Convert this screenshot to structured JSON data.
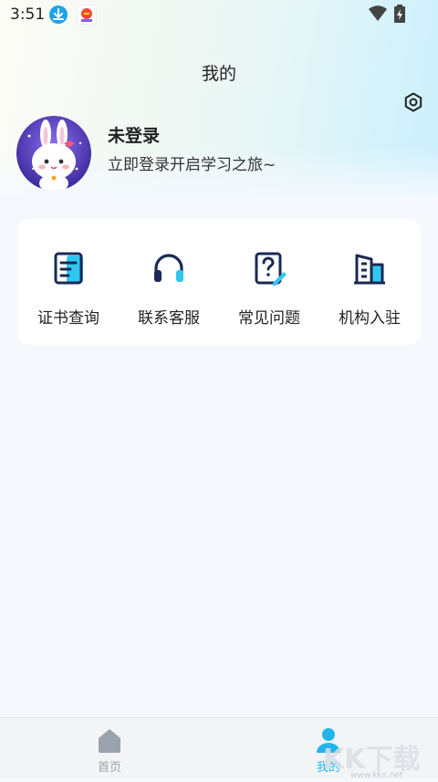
{
  "status_bar": {
    "time": "3:51"
  },
  "header": {
    "title": "我的"
  },
  "profile": {
    "name": "未登录",
    "subtitle": "立即登录开启学习之旅~"
  },
  "menu": {
    "items": [
      {
        "label": "证书查询",
        "icon": "certificate-icon"
      },
      {
        "label": "联系客服",
        "icon": "headset-icon"
      },
      {
        "label": "常见问题",
        "icon": "faq-icon"
      },
      {
        "label": "机构入驻",
        "icon": "building-icon"
      }
    ]
  },
  "tabbar": {
    "items": [
      {
        "label": "首页",
        "icon": "home-icon",
        "active": false
      },
      {
        "label": "我的",
        "icon": "user-icon",
        "active": true
      }
    ]
  },
  "watermark": {
    "brand": "KK下载",
    "url": "www.kkx.net"
  },
  "colors": {
    "accent": "#1fb6f0",
    "icon_dark": "#1a2a55",
    "icon_light": "#2fc7f0",
    "tab_inactive": "#9aa3ad"
  }
}
